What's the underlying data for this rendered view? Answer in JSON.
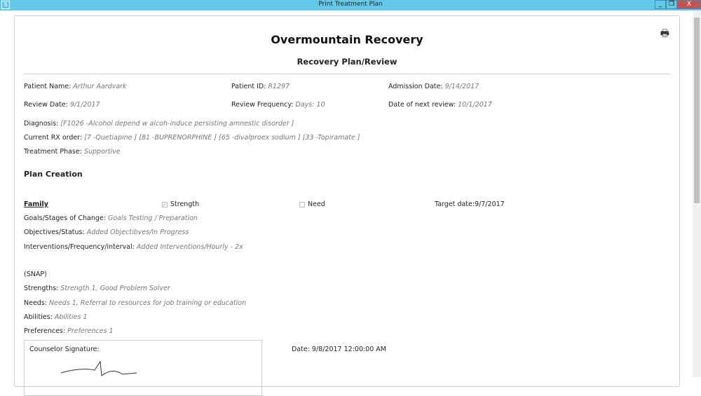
{
  "window": {
    "title": "Print Treatment Plan",
    "minimize": "_",
    "restore": "❐",
    "close": "X"
  },
  "org": "Overmountain Recovery",
  "subtitle": "Recovery Plan/Review",
  "fields": {
    "patient_name": {
      "label": "Patient Name:",
      "value": "Arthur Aardvark"
    },
    "patient_id": {
      "label": "Patient ID:",
      "value": "R1297"
    },
    "admission": {
      "label": "Admission Date:",
      "value": "9/14/2017"
    },
    "review_date": {
      "label": "Review Date:",
      "value": "9/1/2017"
    },
    "review_freq": {
      "label": "Review Frequency:",
      "value": "Days: 10"
    },
    "next_review": {
      "label": "Date of next review:",
      "value": "10/1/2017"
    },
    "diagnosis": {
      "label": "Diagnosis:",
      "value": "[F1026 -Alcohol depend w alcoh-induce persisting amnestic disorder ]"
    },
    "rx": {
      "label": "Current RX order:",
      "value": "[7 -Quetiapine ] [81 -BUPRENORPHINE ] [65 -divalproex sodium ] [33 -Topiramate ]"
    },
    "phase": {
      "label": "Treatment Phase:",
      "value": "Supportive"
    }
  },
  "plan": {
    "heading": "Plan Creation",
    "area": "Family",
    "strength": "Strength",
    "strength_checked": true,
    "need": "Need",
    "need_checked": false,
    "target": "Target date:9/7/2017",
    "goals": {
      "label": "Goals/Stages of Change:",
      "value": "Goals Testing / Preparation"
    },
    "objectives": {
      "label": "Objectives/Status:",
      "value": "Added Objectibves/In Progress"
    },
    "interventions": {
      "label": "Interventions/Frequency/interval:",
      "value": "Added Interventions/Hourly - 2x"
    }
  },
  "snap": {
    "heading": "(SNAP)",
    "strengths": {
      "label": "Strengths:",
      "value": "Strength 1, Good Problem Solver"
    },
    "needs": {
      "label": "Needs:",
      "value": "Needs 1, Referral to resources for job training or education"
    },
    "abilities": {
      "label": "Abilities:",
      "value": "Abilities 1"
    },
    "preferences": {
      "label": "Preferences:",
      "value": "Preferences 1"
    }
  },
  "signature": {
    "label": "Counselor Signature:",
    "date": "Date: 9/8/2017 12:00:00 AM"
  }
}
